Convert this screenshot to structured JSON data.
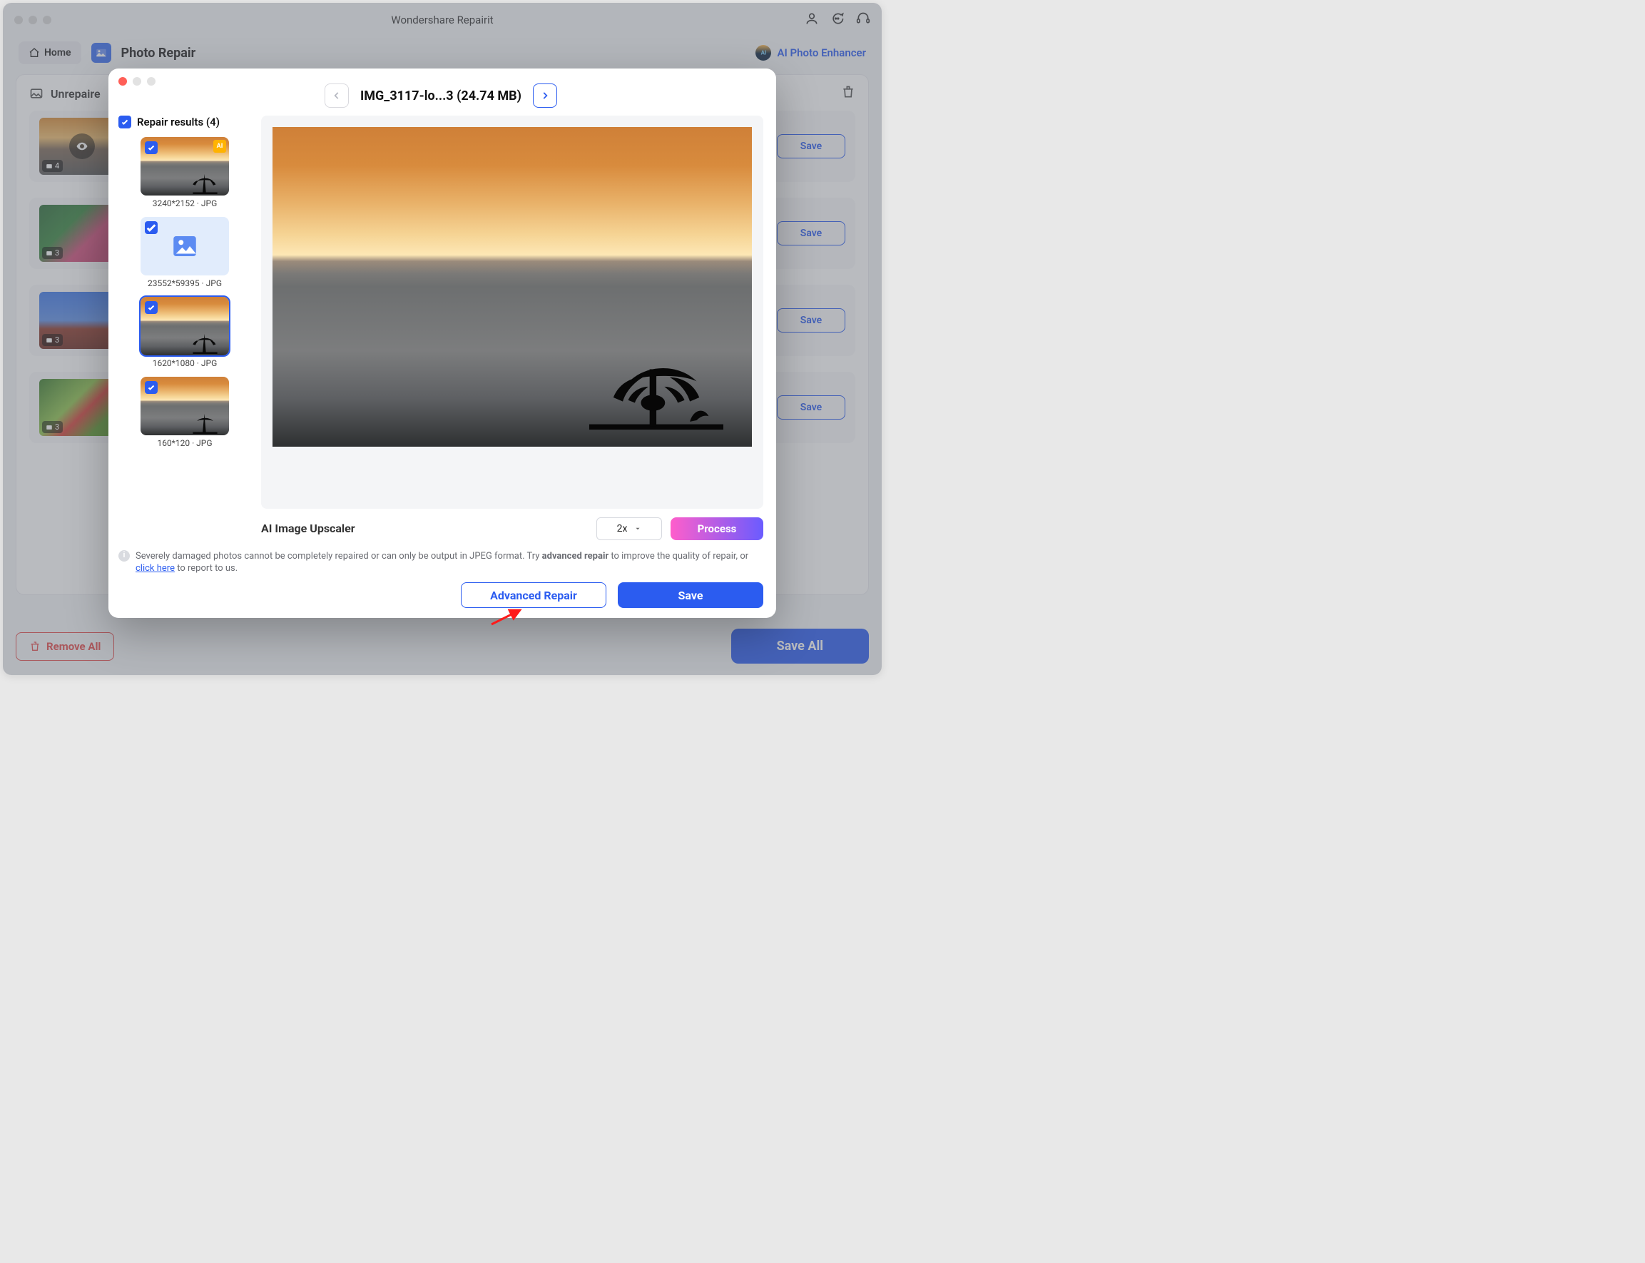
{
  "app": {
    "title": "Wondershare Repairit"
  },
  "header": {
    "home": "Home",
    "section_title": "Photo Repair",
    "ai_enhancer": "AI Photo Enhancer"
  },
  "panel": {
    "title_prefix": "Unrepaire",
    "rows": [
      {
        "count": "4",
        "save": "Save"
      },
      {
        "count": "3",
        "save": "Save"
      },
      {
        "count": "3",
        "save": "Save"
      },
      {
        "count": "3",
        "save": "Save"
      }
    ]
  },
  "footer": {
    "remove_all": "Remove All",
    "save_all": "Save All"
  },
  "modal": {
    "file_title": "IMG_3117-lo...3 (24.74 MB)",
    "results_label": "Repair results (4)",
    "items": [
      {
        "caption": "3240*2152 · JPG",
        "ai": true
      },
      {
        "caption": "23552*59395 · JPG",
        "placeholder": true
      },
      {
        "caption": "1620*1080 · JPG",
        "selected": true
      },
      {
        "caption": "160*120 · JPG"
      }
    ],
    "upscaler_label": "AI Image Upscaler",
    "upscaler_value": "2x",
    "process": "Process",
    "note_pre": "Severely damaged photos cannot be completely repaired or can only be output in JPEG format. Try ",
    "note_bold": "advanced repair",
    "note_mid": " to improve the quality of repair, or ",
    "note_link": "click here",
    "note_post": " to report to us.",
    "advanced_repair": "Advanced Repair",
    "save": "Save"
  }
}
